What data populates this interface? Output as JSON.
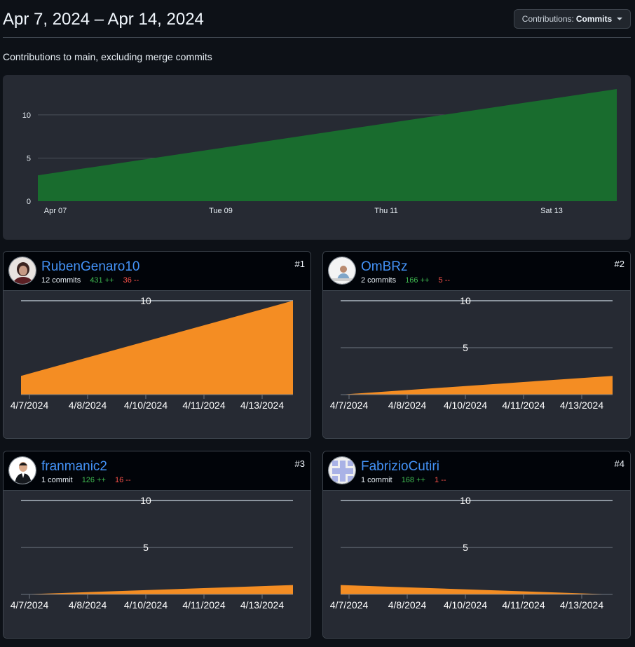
{
  "header": {
    "title": "Apr 7, 2024 – Apr 14, 2024",
    "contrib_label": "Contributions:",
    "contrib_value": "Commits",
    "subtitle": "Contributions to main, excluding merge commits"
  },
  "colors": {
    "main_area": "#196c2e",
    "contributor_area": "#f48d23",
    "link": "#4493f8",
    "additions": "#3fb950",
    "deletions": "#f85149"
  },
  "chart_data": [
    {
      "type": "area",
      "title": "",
      "x": [
        "Apr 07",
        "Apr 14"
      ],
      "x_ticks": [
        "Apr 07",
        "Tue 09",
        "Thu 11",
        "Sat 13"
      ],
      "y_ticks": [
        "0",
        "5",
        "10"
      ],
      "ylim": [
        0,
        13
      ],
      "series": [
        {
          "values": [
            3,
            13
          ]
        }
      ],
      "grid": true
    },
    {
      "type": "area",
      "x": [
        "4/7/2024",
        "4/14/2024"
      ],
      "x_ticks": [
        "4/7/2024",
        "4/8/2024",
        "4/10/2024",
        "4/11/2024",
        "4/13/2024"
      ],
      "y_ticks": [
        "10"
      ],
      "ylim": [
        0,
        10
      ],
      "series": [
        {
          "values": [
            2,
            10
          ]
        }
      ]
    },
    {
      "type": "area",
      "x": [
        "4/7/2024",
        "4/14/2024"
      ],
      "x_ticks": [
        "4/7/2024",
        "4/8/2024",
        "4/10/2024",
        "4/11/2024",
        "4/13/2024"
      ],
      "y_ticks": [
        "5",
        "10"
      ],
      "ylim": [
        0,
        10
      ],
      "series": [
        {
          "values": [
            0,
            2
          ]
        }
      ]
    },
    {
      "type": "area",
      "x": [
        "4/7/2024",
        "4/14/2024"
      ],
      "x_ticks": [
        "4/7/2024",
        "4/8/2024",
        "4/10/2024",
        "4/11/2024",
        "4/13/2024"
      ],
      "y_ticks": [
        "5",
        "10"
      ],
      "ylim": [
        0,
        10
      ],
      "series": [
        {
          "values": [
            0,
            1
          ]
        }
      ]
    },
    {
      "type": "area",
      "x": [
        "4/7/2024",
        "4/14/2024"
      ],
      "x_ticks": [
        "4/7/2024",
        "4/8/2024",
        "4/10/2024",
        "4/11/2024",
        "4/13/2024"
      ],
      "y_ticks": [
        "5",
        "10"
      ],
      "ylim": [
        0,
        10
      ],
      "series": [
        {
          "values": [
            1,
            0
          ]
        }
      ]
    }
  ],
  "contributors": [
    {
      "name": "RubenGenaro10",
      "commits": "12 commits",
      "additions": "431 ++",
      "deletions": "36 --",
      "rank": "#1",
      "avatar_icon": "user-photo-icon"
    },
    {
      "name": "OmBRz",
      "commits": "2 commits",
      "additions": "166 ++",
      "deletions": "5 --",
      "rank": "#2",
      "avatar_icon": "user-photo-icon"
    },
    {
      "name": "franmanic2",
      "commits": "1 commit",
      "additions": "126 ++",
      "deletions": "16 --",
      "rank": "#3",
      "avatar_icon": "user-photo-icon"
    },
    {
      "name": "FabrizioCutiri",
      "commits": "1 commit",
      "additions": "168 ++",
      "deletions": "1 --",
      "rank": "#4",
      "avatar_icon": "identicon-icon"
    }
  ]
}
